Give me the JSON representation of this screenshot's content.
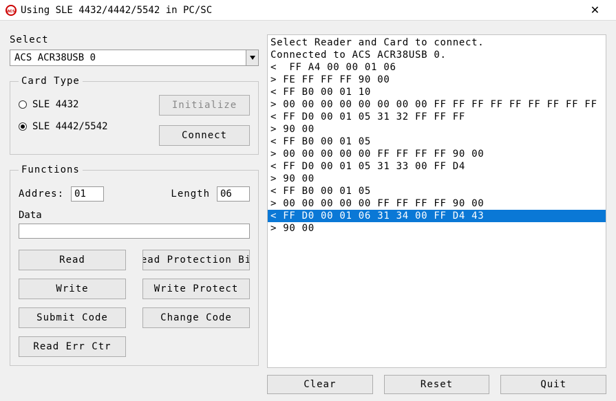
{
  "window": {
    "title": "Using SLE 4432/4442/5542 in PC/SC"
  },
  "select": {
    "label": "Select",
    "value": "ACS ACR38USB 0"
  },
  "cardType": {
    "legend": "Card Type",
    "options": [
      "SLE 4432",
      "SLE 4442/5542"
    ],
    "selectedIndex": 1,
    "buttons": {
      "initialize": "Initialize",
      "connect": "Connect"
    }
  },
  "functions": {
    "legend": "Functions",
    "addressLabel": "Addres:",
    "addressValue": "01",
    "lengthLabel": "Length",
    "lengthValue": "06",
    "dataLabel": "Data",
    "dataValue": "",
    "buttons": {
      "read": "Read",
      "readProtBit": "ead Protection Bi",
      "write": "Write",
      "writeProtect": "Write Protect",
      "submitCode": "Submit Code",
      "changeCode": "Change Code",
      "readErrCtr": "Read Err Ctr"
    }
  },
  "log": {
    "lines": [
      "Select Reader and Card to connect.",
      "Connected to ACS ACR38USB 0.",
      "<  FF A4 00 00 01 06",
      "> FE FF FF FF 90 00",
      "< FF B0 00 01 10",
      "> 00 00 00 00 00 00 00 00 FF FF FF FF FF FF FF FF FF",
      "< FF D0 00 01 05 31 32 FF FF FF",
      "> 90 00",
      "< FF B0 00 01 05",
      "> 00 00 00 00 00 FF FF FF FF 90 00",
      "< FF D0 00 01 05 31 33 00 FF D4",
      "> 90 00",
      "< FF B0 00 01 05",
      "> 00 00 00 00 00 FF FF FF FF 90 00",
      "< FF D0 00 01 06 31 34 00 FF D4 43",
      "> 90 00"
    ],
    "selectedIndex": 14
  },
  "bottom": {
    "clear": "Clear",
    "reset": "Reset",
    "quit": "Quit"
  }
}
